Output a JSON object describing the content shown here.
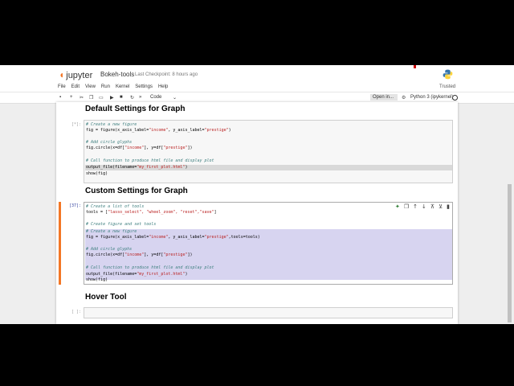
{
  "header": {
    "logo_text": "jupyter",
    "notebook_name": "Bokeh-tools",
    "checkpoint": "Last Checkpoint: 8 hours ago",
    "trusted": "Trusted"
  },
  "menu": [
    "File",
    "Edit",
    "View",
    "Run",
    "Kernel",
    "Settings",
    "Help"
  ],
  "toolbar": {
    "cell_type": "Code",
    "open_in": "Open in...",
    "kernel": "Python 3 (ipykernel)"
  },
  "cells": {
    "h_default": "Default Settings for Graph",
    "c1_prompt": "[*]:",
    "c1_l1": "# Create a new figure",
    "c1_l2a": "fig = figure(x_axis_label=",
    "c1_l2b": "\"income\"",
    "c1_l2c": ", y_axis_label=",
    "c1_l2d": "\"prestige\"",
    "c1_l2e": ")",
    "c1_l3": "# Add circle glyphs",
    "c1_l4a": "fig.circle(x=df[",
    "c1_l4b": "\"income\"",
    "c1_l4c": "], y=df[",
    "c1_l4d": "\"prestige\"",
    "c1_l4e": "])",
    "c1_l5": "# Call function to produce html file and display plot",
    "c1_l6a": "output_file(filename=",
    "c1_l6b": "\"my_first_plot.html\"",
    "c1_l6c": ")",
    "c1_l7": "show(fig)",
    "h_custom": "Custom Settings for Graph",
    "c2_prompt": "[37]:",
    "c2_l1": "# Create a list of tools",
    "c2_l2a": "tools = [",
    "c2_l2b": "\"lasso_select\", \"wheel_zoom\", \"reset\",\"save\"",
    "c2_l2c": "]",
    "c2_l3": "# Create figure and set tools",
    "c2_l4": "# Create a new figure",
    "c2_l5a": "fig = figure(x_axis_label=",
    "c2_l5b": "\"income\"",
    "c2_l5c": ", y_axis_label=",
    "c2_l5d": "\"prestige\"",
    "c2_l5e": ",tools=tools)",
    "c2_l6": "# Add circle glyphs",
    "c2_l7a": "fig.circle(x=df[",
    "c2_l7b": "\"income\"",
    "c2_l7c": "], y=df[",
    "c2_l7d": "\"prestige\"",
    "c2_l7e": "])",
    "c2_l8": "# Call function to produce html file and display plot",
    "c2_l9a": "output_file(filename=",
    "c2_l9b": "\"my_first_plot.html\"",
    "c2_l9c": ")",
    "c2_l10": "show(fig)",
    "h_hover": "Hover Tool",
    "c3_prompt": "[ ]:"
  }
}
